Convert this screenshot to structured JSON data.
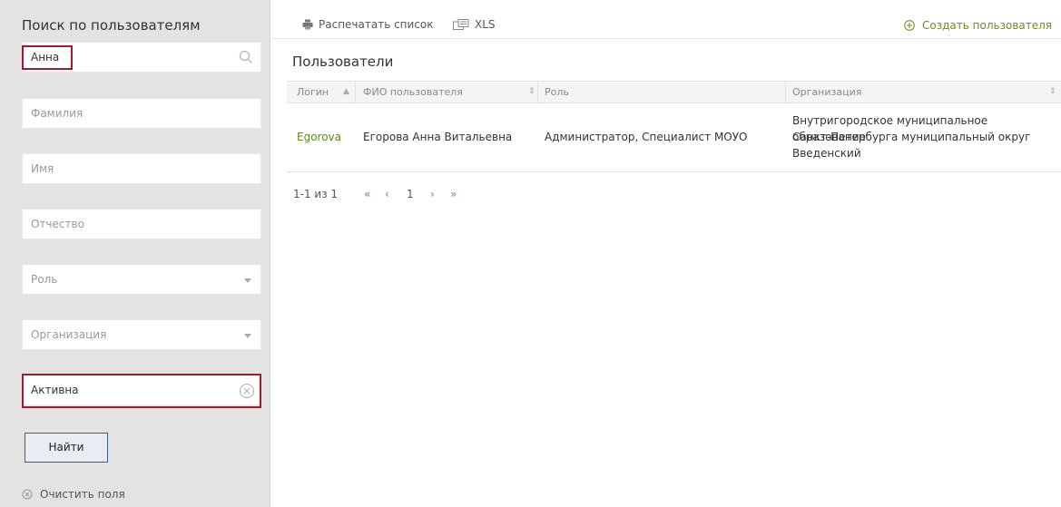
{
  "sidebar": {
    "title": "Поиск по пользователям",
    "search": {
      "value": "Анна"
    },
    "surname": {
      "placeholder": "Фамилия"
    },
    "name": {
      "placeholder": "Имя"
    },
    "patronymic": {
      "placeholder": "Отчество"
    },
    "role": {
      "placeholder": "Роль"
    },
    "organization": {
      "placeholder": "Организация"
    },
    "status": {
      "value": "Активна"
    },
    "find_label": "Найти",
    "clear_label": "Очистить поля"
  },
  "toolbar": {
    "print_label": "Распечатать список",
    "xls_label": "XLS",
    "create_label": "Создать пользователя"
  },
  "page_title": "Пользователи",
  "table": {
    "headers": [
      "Логин",
      "ФИО пользователя",
      "Роль",
      "Организация"
    ],
    "rows": [
      {
        "login": "Egorova",
        "fio": "Егорова Анна Витальевна",
        "role": "Администратор, Специалист МОУО",
        "org_line1": "Внутригородское муниципальное образование",
        "org_line2": "Санкт-Петербурга муниципальный округ",
        "org_line3": "Введенский"
      }
    ]
  },
  "pager": {
    "range": "1-1 из 1",
    "current": "1"
  },
  "colors": {
    "accent_green": "#6b8f1a",
    "highlight_red": "#a21a2e",
    "button_border": "#3b5d9a"
  },
  "icons": [
    "search-icon",
    "clear-circle-icon",
    "print-icon",
    "xls-icon",
    "plus-circle-icon",
    "sort-asc-icon",
    "sort-both-icon",
    "first-page-icon",
    "prev-page-icon",
    "next-page-icon",
    "last-page-icon"
  ]
}
